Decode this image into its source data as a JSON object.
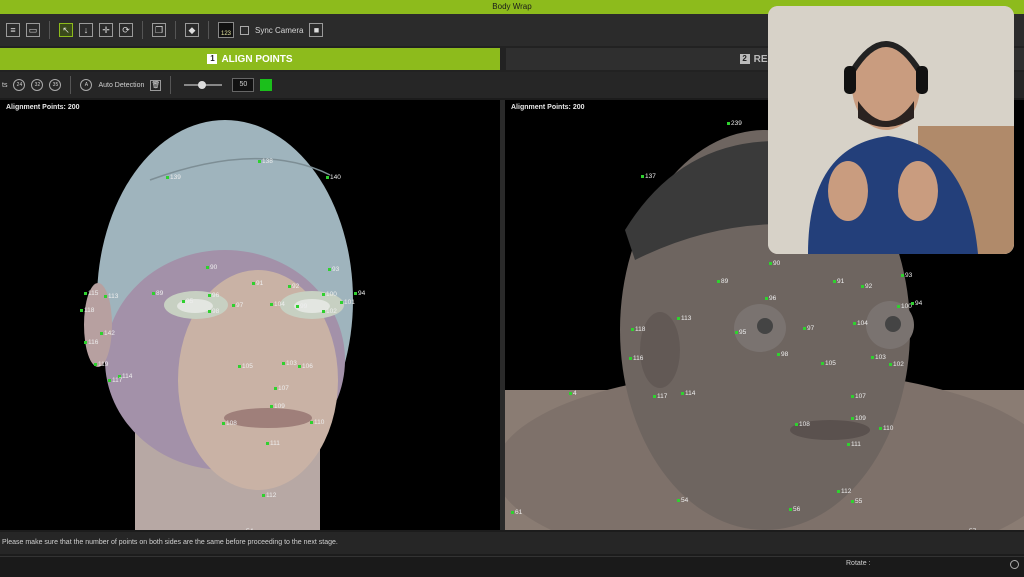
{
  "window": {
    "title": "Body Wrap"
  },
  "toolbar": {
    "sync_camera_label": "Sync Camera",
    "badge_value": "123"
  },
  "tabs": [
    {
      "number": "1",
      "label": "ALIGN POINTS"
    },
    {
      "number": "2",
      "label": "REFINE"
    }
  ],
  "options": {
    "points_label": "ts",
    "point_presets": [
      "24",
      "32",
      "35"
    ],
    "auto_detection_label": "Auto Detection",
    "slider_value": "50",
    "point_color": "#1bbf1b"
  },
  "left_viewport": {
    "label": "Alignment Points: 200",
    "points": [
      "138",
      "140",
      "139",
      "90",
      "91",
      "92",
      "93",
      "89",
      "96",
      "95",
      "97",
      "98",
      "104",
      "99",
      "100",
      "101",
      "94",
      "102",
      "115",
      "113",
      "118",
      "142",
      "116",
      "119",
      "114",
      "117",
      "105",
      "103",
      "106",
      "107",
      "109",
      "108",
      "110",
      "111",
      "112",
      "54"
    ]
  },
  "right_viewport": {
    "label": "Alignment Points: 200",
    "points": [
      "239",
      "137",
      "90",
      "93",
      "89",
      "91",
      "92",
      "96",
      "100",
      "94",
      "113",
      "118",
      "95",
      "97",
      "104",
      "98",
      "116",
      "103",
      "105",
      "102",
      "117",
      "114",
      "4",
      "107",
      "109",
      "108",
      "110",
      "111",
      "112",
      "56",
      "55",
      "61",
      "57",
      "54"
    ]
  },
  "status": {
    "message": "Please make sure that the number of points on both sides are the same before proceeding to the next stage."
  },
  "bottom": {
    "rotate_label": "Rotate :"
  },
  "colors": {
    "accent": "#8dbb1c",
    "point": "#2fd12f"
  }
}
